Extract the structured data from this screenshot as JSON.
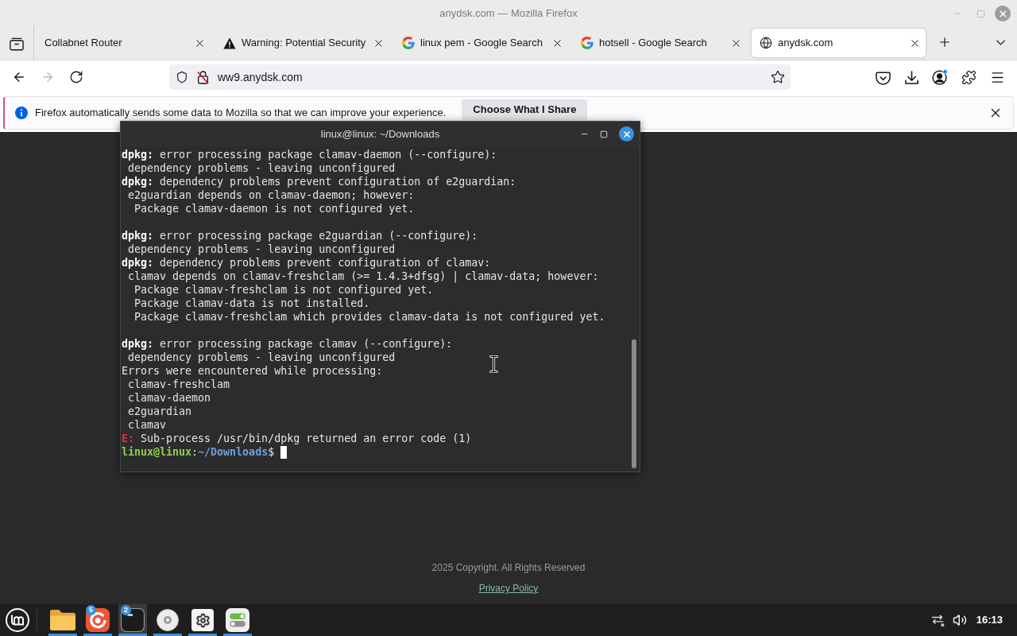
{
  "window": {
    "title": "anydsk.com — Mozilla Firefox"
  },
  "tabs": [
    {
      "kind": "plain",
      "title": "Collabnet Router",
      "selected": false
    },
    {
      "kind": "warning",
      "title": "Warning: Potential Security",
      "selected": false
    },
    {
      "kind": "search",
      "title": "linux pem - Google Search",
      "selected": false
    },
    {
      "kind": "search",
      "title": "hotsell - Google Search",
      "selected": false
    },
    {
      "kind": "site",
      "title": "anydsk.com",
      "selected": true
    }
  ],
  "nav_buttons": [
    {
      "kind": "back",
      "disabled": false
    },
    {
      "kind": "forward",
      "disabled": true
    },
    {
      "kind": "reload",
      "disabled": false
    }
  ],
  "url_bar": {
    "value": "ww9.anydsk.com"
  },
  "toolbar_buttons": [
    {
      "kind": "pocket",
      "attention": false
    },
    {
      "kind": "downloads",
      "attention": false
    },
    {
      "kind": "account",
      "attention": true
    },
    {
      "kind": "extensions",
      "attention": false
    },
    {
      "kind": "menu",
      "attention": false
    }
  ],
  "notification": {
    "text": "Firefox automatically sends some data to Mozilla so that we can improve your experience.",
    "button": "Choose What I Share"
  },
  "terminal": {
    "title": "linux@linux: ~/Downloads",
    "lines": [
      {
        "kind": "message",
        "text": "**dpkg:** error processing package clamav-daemon (--configure):"
      },
      {
        "kind": "output",
        "text": " dependency problems - leaving unconfigured"
      },
      {
        "kind": "message",
        "text": "**dpkg:** dependency problems prevent configuration of e2guardian:"
      },
      {
        "kind": "output",
        "text": " e2guardian depends on clamav-daemon; however:"
      },
      {
        "kind": "output",
        "text": "  Package clamav-daemon is not configured yet."
      },
      {
        "kind": "blank"
      },
      {
        "kind": "message",
        "text": "**dpkg:** error processing package e2guardian (--configure):"
      },
      {
        "kind": "output",
        "text": " dependency problems - leaving unconfigured"
      },
      {
        "kind": "message",
        "text": "**dpkg:** dependency problems prevent configuration of clamav:"
      },
      {
        "kind": "output",
        "text": " clamav depends on clamav-freshclam (>= 1.4.3+dfsg) | clamav-data; however:"
      },
      {
        "kind": "output",
        "text": "  Package clamav-freshclam is not configured yet."
      },
      {
        "kind": "output",
        "text": "  Package clamav-data is not installed."
      },
      {
        "kind": "output",
        "text": "  Package clamav-freshclam which provides clamav-data is not configured yet."
      },
      {
        "kind": "blank"
      },
      {
        "kind": "message",
        "text": "**dpkg:** error processing package clamav (--configure):"
      },
      {
        "kind": "output",
        "text": " dependency problems - leaving unconfigured"
      },
      {
        "kind": "output",
        "text": "Errors were encountered while processing:"
      },
      {
        "kind": "output",
        "text": " clamav-freshclam"
      },
      {
        "kind": "output",
        "text": " clamav-daemon"
      },
      {
        "kind": "output",
        "text": " e2guardian"
      },
      {
        "kind": "output",
        "text": " clamav"
      },
      {
        "kind": "error",
        "text": "**E:** Sub-process /usr/bin/dpkg returned an error code (1)"
      }
    ],
    "prompt": {
      "user_host": "linux@linux",
      "separator": ":",
      "path": "~/Downloads",
      "symbol": "$"
    }
  },
  "footer": {
    "copyright": "2025 Copyright. All Rights Reserved",
    "link": "Privacy Policy"
  },
  "taskbar": {
    "apps": [
      {
        "kind": "files",
        "running": true,
        "selected": false
      },
      {
        "kind": "browser",
        "badge": "5",
        "running": true,
        "selected": false
      },
      {
        "kind": "terminal",
        "badge": "2",
        "running": true,
        "selected": true
      },
      {
        "kind": "disc",
        "running": true,
        "selected": false
      },
      {
        "kind": "settings",
        "running": true,
        "selected": false
      },
      {
        "kind": "toggles",
        "running": true,
        "selected": false
      }
    ],
    "clock": "16:13"
  }
}
